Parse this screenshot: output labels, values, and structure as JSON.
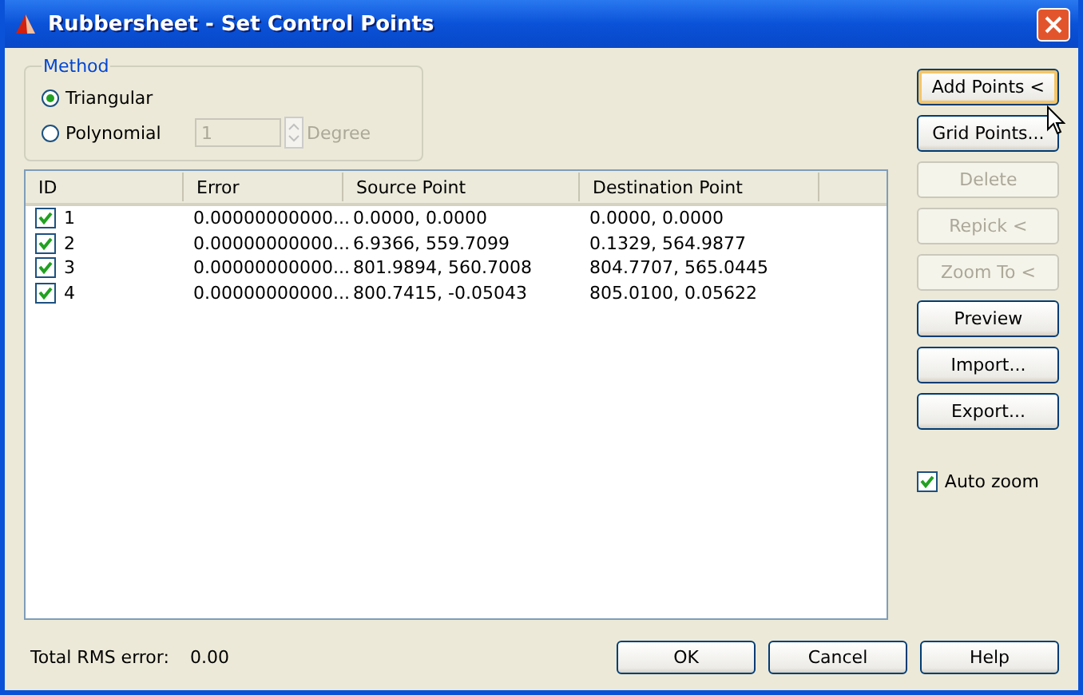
{
  "window": {
    "title": "Rubbersheet - Set Control Points"
  },
  "method": {
    "label": "Method",
    "options": [
      {
        "label": "Triangular",
        "selected": true
      },
      {
        "label": "Polynomial",
        "selected": false
      }
    ],
    "degree": {
      "value": "1",
      "disabled": true,
      "label": "Degree"
    }
  },
  "table": {
    "columns": [
      "ID",
      "Error",
      "Source Point",
      "Destination Point"
    ],
    "rows": [
      {
        "checked": true,
        "id": "1",
        "error": "0.00000000000...",
        "source": "0.0000, 0.0000",
        "destination": "0.0000, 0.0000"
      },
      {
        "checked": true,
        "id": "2",
        "error": "0.00000000000...",
        "source": "6.9366, 559.7099",
        "destination": "0.1329, 564.9877"
      },
      {
        "checked": true,
        "id": "3",
        "error": "0.00000000000...",
        "source": "801.9894, 560.7008",
        "destination": "804.7707, 565.0445"
      },
      {
        "checked": true,
        "id": "4",
        "error": "0.00000000000...",
        "source": "800.7415, -0.05043",
        "destination": "805.0100, 0.05622"
      }
    ]
  },
  "side_buttons": [
    {
      "label": "Add Points <",
      "disabled": false,
      "hovered": true
    },
    {
      "label": "Grid Points...",
      "disabled": false,
      "hovered": false
    },
    {
      "label": "Delete",
      "disabled": true,
      "hovered": false
    },
    {
      "label": "Repick <",
      "disabled": true,
      "hovered": false
    },
    {
      "label": "Zoom To <",
      "disabled": true,
      "hovered": false
    },
    {
      "label": "Preview",
      "disabled": false,
      "hovered": false
    },
    {
      "label": "Import...",
      "disabled": false,
      "hovered": false
    },
    {
      "label": "Export...",
      "disabled": false,
      "hovered": false
    }
  ],
  "auto_zoom": {
    "label": "Auto zoom",
    "checked": true
  },
  "rms": {
    "label": "Total RMS error:",
    "value": "0.00"
  },
  "footer_buttons": [
    "OK",
    "Cancel",
    "Help"
  ]
}
